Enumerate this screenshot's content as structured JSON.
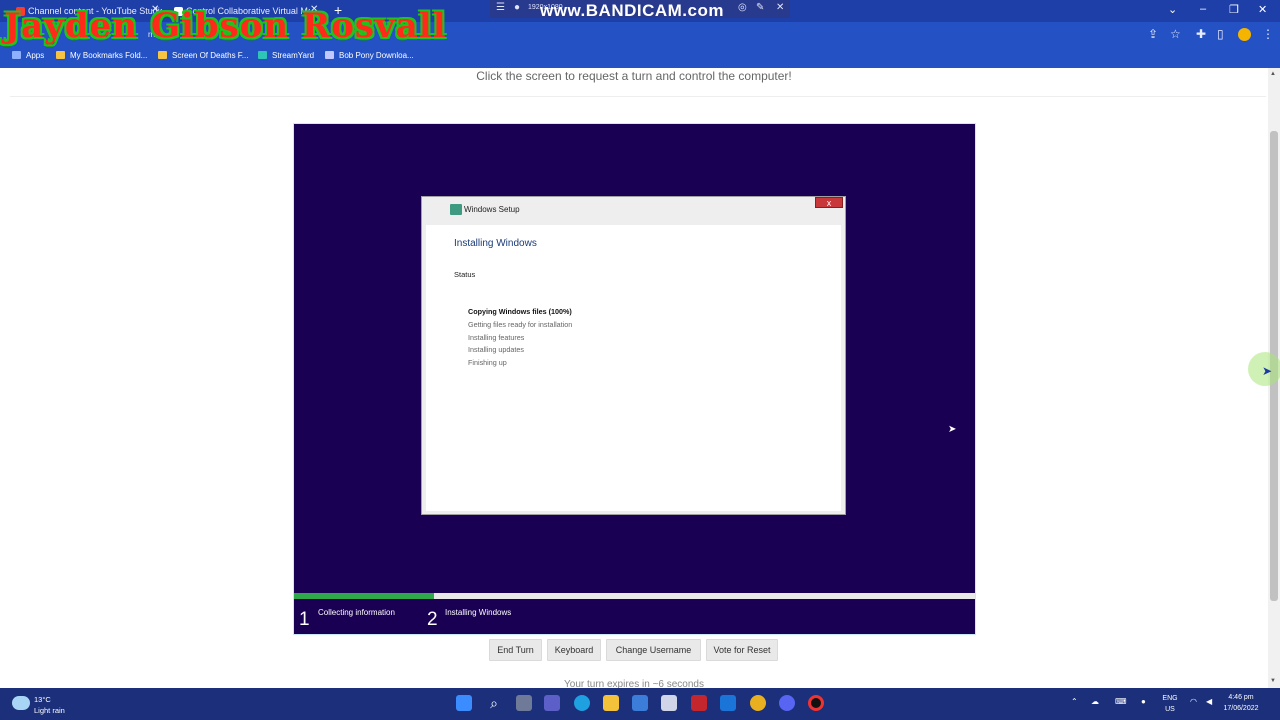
{
  "browser": {
    "tabs": [
      {
        "label": "Channel content - YouTube Studio",
        "favicon_color": "#ff3b30"
      },
      {
        "label": "Control Collaborative Virtual Ma",
        "favicon_color": "#ffffff"
      }
    ],
    "new_tab_icon": "plus-icon",
    "window_controls": [
      "minimize-icon",
      "restore-icon",
      "close-icon"
    ],
    "recorder": {
      "resolution": "1920x1080",
      "brand": "www.BANDICAM.com"
    },
    "address_partial": "rne",
    "bookmarks": [
      {
        "label": "Apps",
        "icon": "apps-grid-icon"
      },
      {
        "label": "My Bookmarks Fold...",
        "icon": "folder-icon"
      },
      {
        "label": "Screen Of Deaths F...",
        "icon": "folder-icon"
      },
      {
        "label": "StreamYard",
        "icon": "streamyard-icon"
      },
      {
        "label": "Bob Pony Downloa...",
        "icon": "bobpony-icon"
      }
    ],
    "watermark": "Jayden Gibson Rosvall"
  },
  "page": {
    "instruction": "Click the screen to request a turn and control the computer!",
    "turn_text": "Your turn expires in ~6 seconds",
    "buttons": {
      "end_turn": "End Turn",
      "keyboard": "Keyboard",
      "change_username": "Change Username",
      "vote_reset": "Vote for Reset"
    }
  },
  "vm": {
    "background": "#1a0052",
    "setup_window": {
      "title": "Windows Setup",
      "close": "x",
      "heading": "Installing Windows",
      "status_label": "Status",
      "steps": [
        {
          "label": "Copying Windows files (100%)",
          "active": true
        },
        {
          "label": "Getting files ready for installation",
          "active": false
        },
        {
          "label": "Installing features",
          "active": false
        },
        {
          "label": "Installing updates",
          "active": false
        },
        {
          "label": "Finishing up",
          "active": false
        }
      ]
    },
    "progress_fraction": 0.205,
    "phases": [
      {
        "number": "1",
        "label": "Collecting information"
      },
      {
        "number": "2",
        "label": "Installing Windows"
      }
    ]
  },
  "taskbar": {
    "weather_temp": "13°C",
    "weather_desc": "Light rain",
    "apps": [
      "windows-start-icon",
      "search-icon",
      "task-view-icon",
      "teams-icon",
      "edge-icon",
      "file-explorer-icon",
      "store-icon",
      "office-icon",
      "mail-icon",
      "chrome-icon",
      "discord-icon",
      "bandicam-record-icon"
    ],
    "lang_top": "ENG",
    "lang_bottom": "US",
    "time": "4:46 pm",
    "date": "17/06/2022"
  }
}
